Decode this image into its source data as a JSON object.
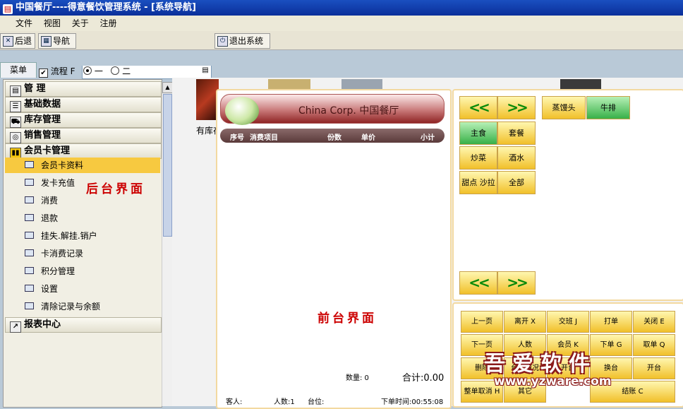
{
  "window": {
    "title": "中国餐厅----得意餐饮管理系统 - [系统导航]"
  },
  "menu": [
    "文件",
    "视图",
    "关于",
    "注册"
  ],
  "toolbar": {
    "back": "后退",
    "nav": "导航",
    "exit": "退出系统"
  },
  "tabs": {
    "menu_tab": "菜单",
    "flow_label": "流程 F",
    "radio_one": "一",
    "radio_two": "二"
  },
  "sidebar": {
    "categories": [
      "管 理",
      "基础数据",
      "库存管理",
      "销售管理",
      "会员卡管理",
      "报表中心"
    ],
    "items": [
      "会员卡资料",
      "发卡充值",
      "消费",
      "退款",
      "挂失.解挂.销户",
      "卡消费记录",
      "积分管理",
      "设置",
      "清除记录与余额"
    ],
    "annotation": "后台界面"
  },
  "stock_label": "有库存",
  "front": {
    "banner": "China Corp. 中国餐厅",
    "columns": [
      "序号",
      "消费项目",
      "份数",
      "单价",
      "小计"
    ],
    "annotation": "前台界面",
    "qty": "数量: 0",
    "total": "合计:0.00",
    "guest": "客人:",
    "people": "人数:1",
    "table": "台位:",
    "order_time": "下单时间:00:55:08"
  },
  "food": {
    "items": [
      "蒸馒头",
      "牛排"
    ],
    "categories": [
      "主食",
      "套餐",
      "炒菜",
      "酒水",
      "甜点 沙拉",
      "全部"
    ],
    "nav_prev": "<<",
    "nav_next": ">>"
  },
  "actions": {
    "row1": [
      "上一页",
      "离开 X",
      "交班 J",
      "打单",
      "关闭 E"
    ],
    "row2": [
      "下一页",
      "人数",
      "会员 K",
      "下单 G",
      "取单 Q"
    ],
    "row3": [
      "删除",
      "台位情况",
      "开台",
      "换台",
      "开台"
    ],
    "row4": [
      "整单取消 H",
      "其它",
      "结账 C"
    ]
  },
  "watermark": {
    "text": "吾爱软件",
    "url": "www.yzware.com"
  }
}
